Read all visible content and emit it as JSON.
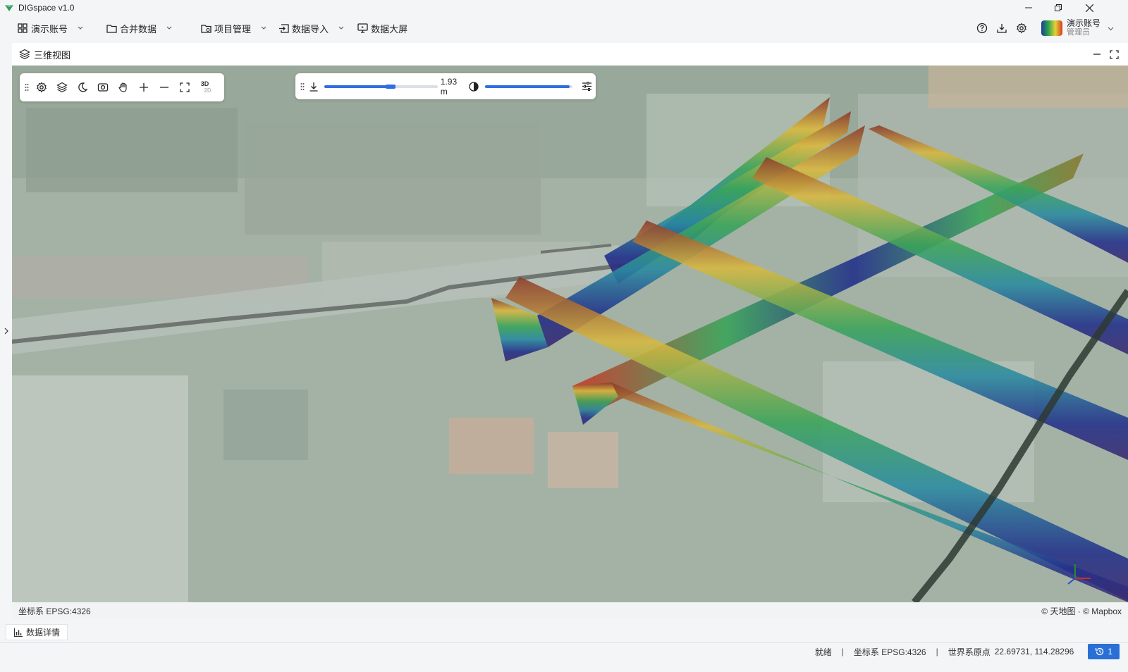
{
  "window": {
    "title": "DIGspace v1.0",
    "minimize_icon": "minimize-icon",
    "restore_icon": "restore-icon",
    "close_icon": "close-icon"
  },
  "menu": {
    "items": [
      {
        "label": "演示账号",
        "icon": "grid-icon"
      },
      {
        "label": "合并数据",
        "icon": "folder-icon"
      },
      {
        "label": "项目管理",
        "icon": "folder-settings-icon"
      },
      {
        "label": "数据导入",
        "icon": "import-icon"
      },
      {
        "label": "数据大屏",
        "icon": "monitor-icon"
      }
    ]
  },
  "user": {
    "name": "演示账号",
    "role": "管理员"
  },
  "panel": {
    "title": "三维视图"
  },
  "toolbar": {
    "depth_value": "1.93 m",
    "mode_3d": "3D",
    "mode_2d": "2D"
  },
  "sliders": {
    "depth_fraction": 0.63,
    "opacity_fraction": 0.97
  },
  "map": {
    "crs_label": "坐标系 EPSG:4326",
    "attribution": "© 天地图 · © Mapbox"
  },
  "bottom": {
    "tab_label": "数据详情"
  },
  "status": {
    "state": "就绪",
    "crs": "坐标系 EPSG:4326",
    "origin_label": "世界系原点",
    "origin_value": "22.69731, 114.28296",
    "badge_count": "1"
  },
  "colors": {
    "accent": "#2f6fe0",
    "status_badge": "#2a6fd6"
  }
}
